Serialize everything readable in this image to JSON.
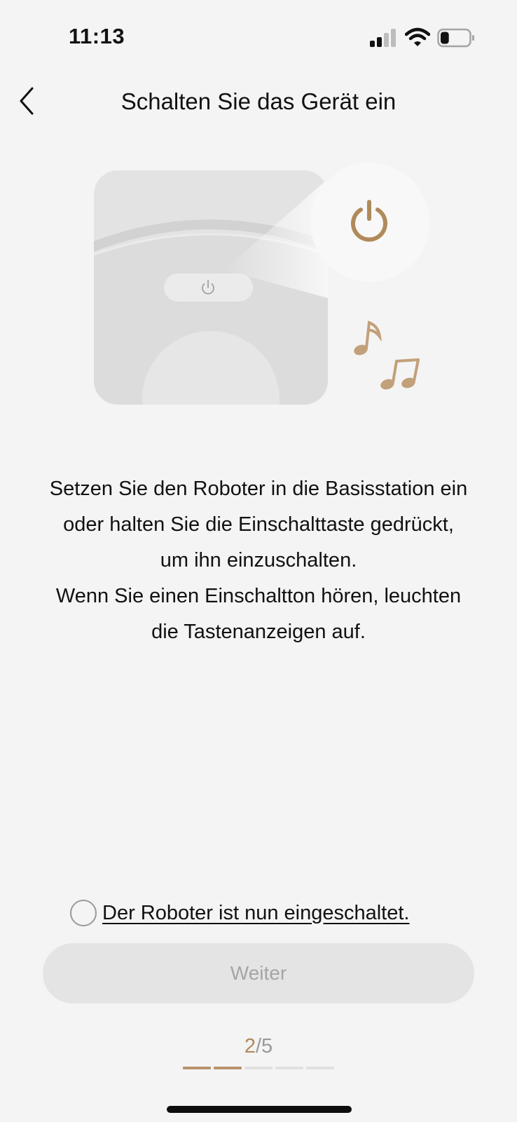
{
  "status_bar": {
    "time": "11:13",
    "signal_icon": "cellular-signal-icon",
    "wifi_icon": "wifi-icon",
    "battery_icon": "battery-icon",
    "battery_level": 0.3
  },
  "nav": {
    "back_icon": "chevron-left-icon",
    "title": "Schalten Sie das Gerät ein"
  },
  "illustration": {
    "robot_icon": "robot-vacuum-icon",
    "power_icon": "power-icon",
    "music_icon": "music-notes-icon",
    "accent_color": "#b08a5a"
  },
  "instructions": {
    "line1": "Setzen Sie den Roboter in die Basisstation ein",
    "line2": "oder halten Sie die Einschalttaste gedrückt,",
    "line3": "um ihn einzuschalten.",
    "line4": "Wenn Sie einen Einschaltton hören, leuchten",
    "line5": "die Tastenanzeigen auf."
  },
  "confirm": {
    "label": "Der Roboter ist nun eingeschaltet.",
    "checked": false
  },
  "next_button": {
    "label": "Weiter",
    "enabled": false
  },
  "progress": {
    "current": "2",
    "separator": "/",
    "total": "5",
    "steps_total": 5,
    "steps_done": 2,
    "active_color": "#b9936a"
  }
}
